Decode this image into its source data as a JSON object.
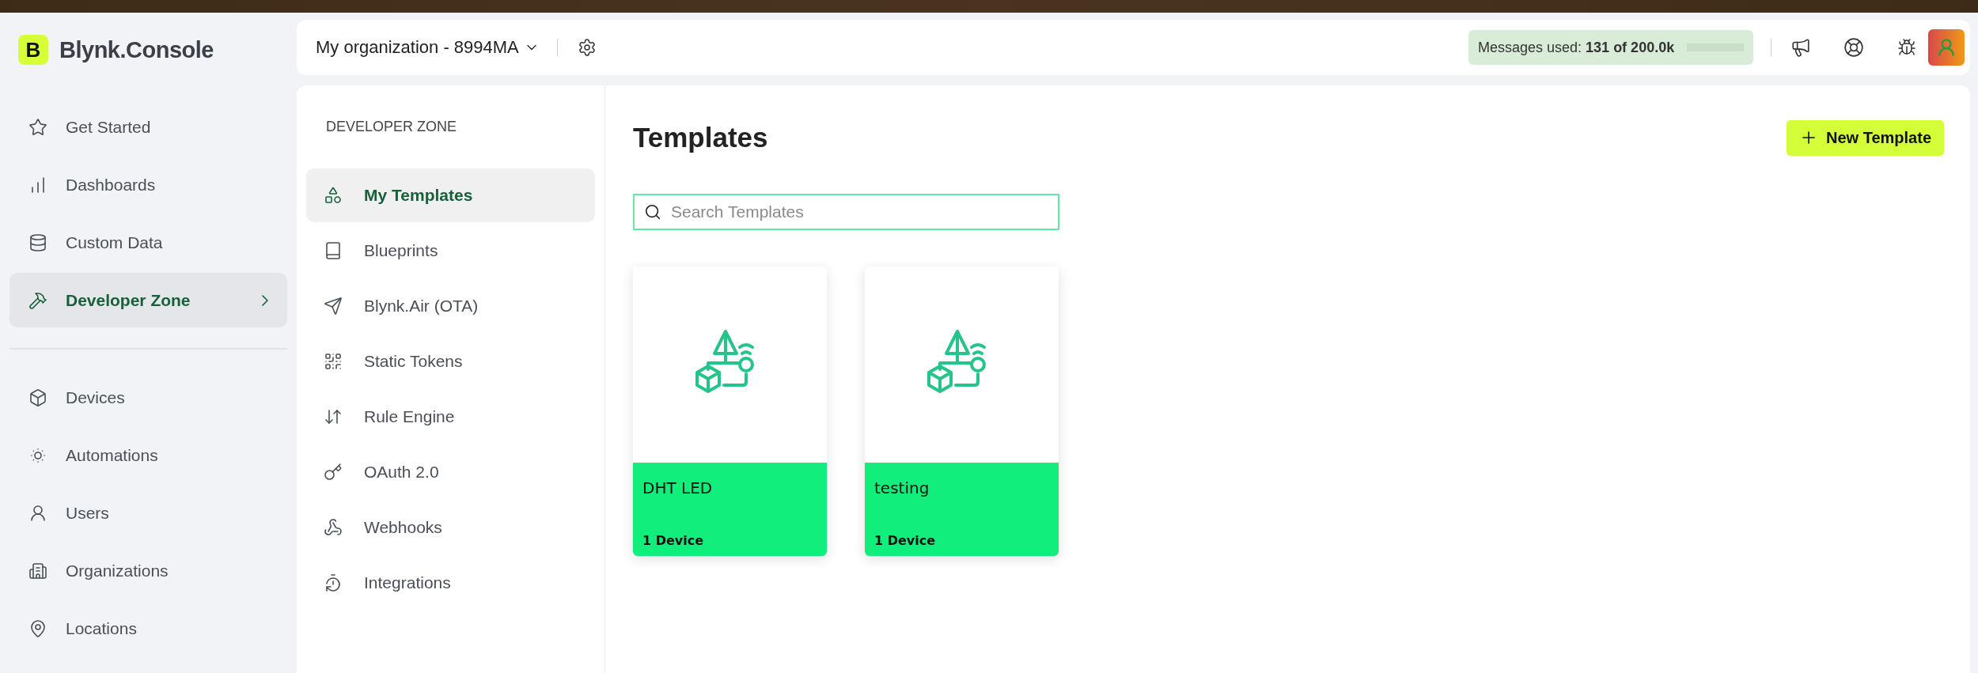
{
  "app": {
    "logo_letter": "B",
    "name": "Blynk.Console"
  },
  "sidebar": {
    "groups": [
      {
        "items": [
          {
            "label": "Get Started",
            "selected": false
          },
          {
            "label": "Dashboards",
            "selected": false
          },
          {
            "label": "Custom Data",
            "selected": false
          },
          {
            "label": "Developer Zone",
            "selected": true
          }
        ]
      },
      {
        "items": [
          {
            "label": "Devices",
            "selected": false
          },
          {
            "label": "Automations",
            "selected": false
          },
          {
            "label": "Users",
            "selected": false
          },
          {
            "label": "Organizations",
            "selected": false
          },
          {
            "label": "Locations",
            "selected": false
          }
        ]
      }
    ]
  },
  "topbar": {
    "organization": "My organization - 8994MA",
    "messages": {
      "label": "Messages used:",
      "value": "131 of 200.0k",
      "level": 0.001
    }
  },
  "developer_zone": {
    "title": "DEVELOPER ZONE",
    "items": [
      {
        "label": "My Templates",
        "selected": true
      },
      {
        "label": "Blueprints",
        "selected": false
      },
      {
        "label": "Blynk.Air (OTA)",
        "selected": false
      },
      {
        "label": "Static Tokens",
        "selected": false
      },
      {
        "label": "Rule Engine",
        "selected": false
      },
      {
        "label": "OAuth 2.0",
        "selected": false
      },
      {
        "label": "Webhooks",
        "selected": false
      },
      {
        "label": "Integrations",
        "selected": false
      }
    ]
  },
  "main": {
    "title": "Templates",
    "new_button": "New Template",
    "search": {
      "placeholder": "Search Templates"
    },
    "templates": [
      {
        "name": "DHT LED",
        "devices": "1 Device"
      },
      {
        "name": "testing",
        "devices": "1 Device"
      }
    ]
  }
}
